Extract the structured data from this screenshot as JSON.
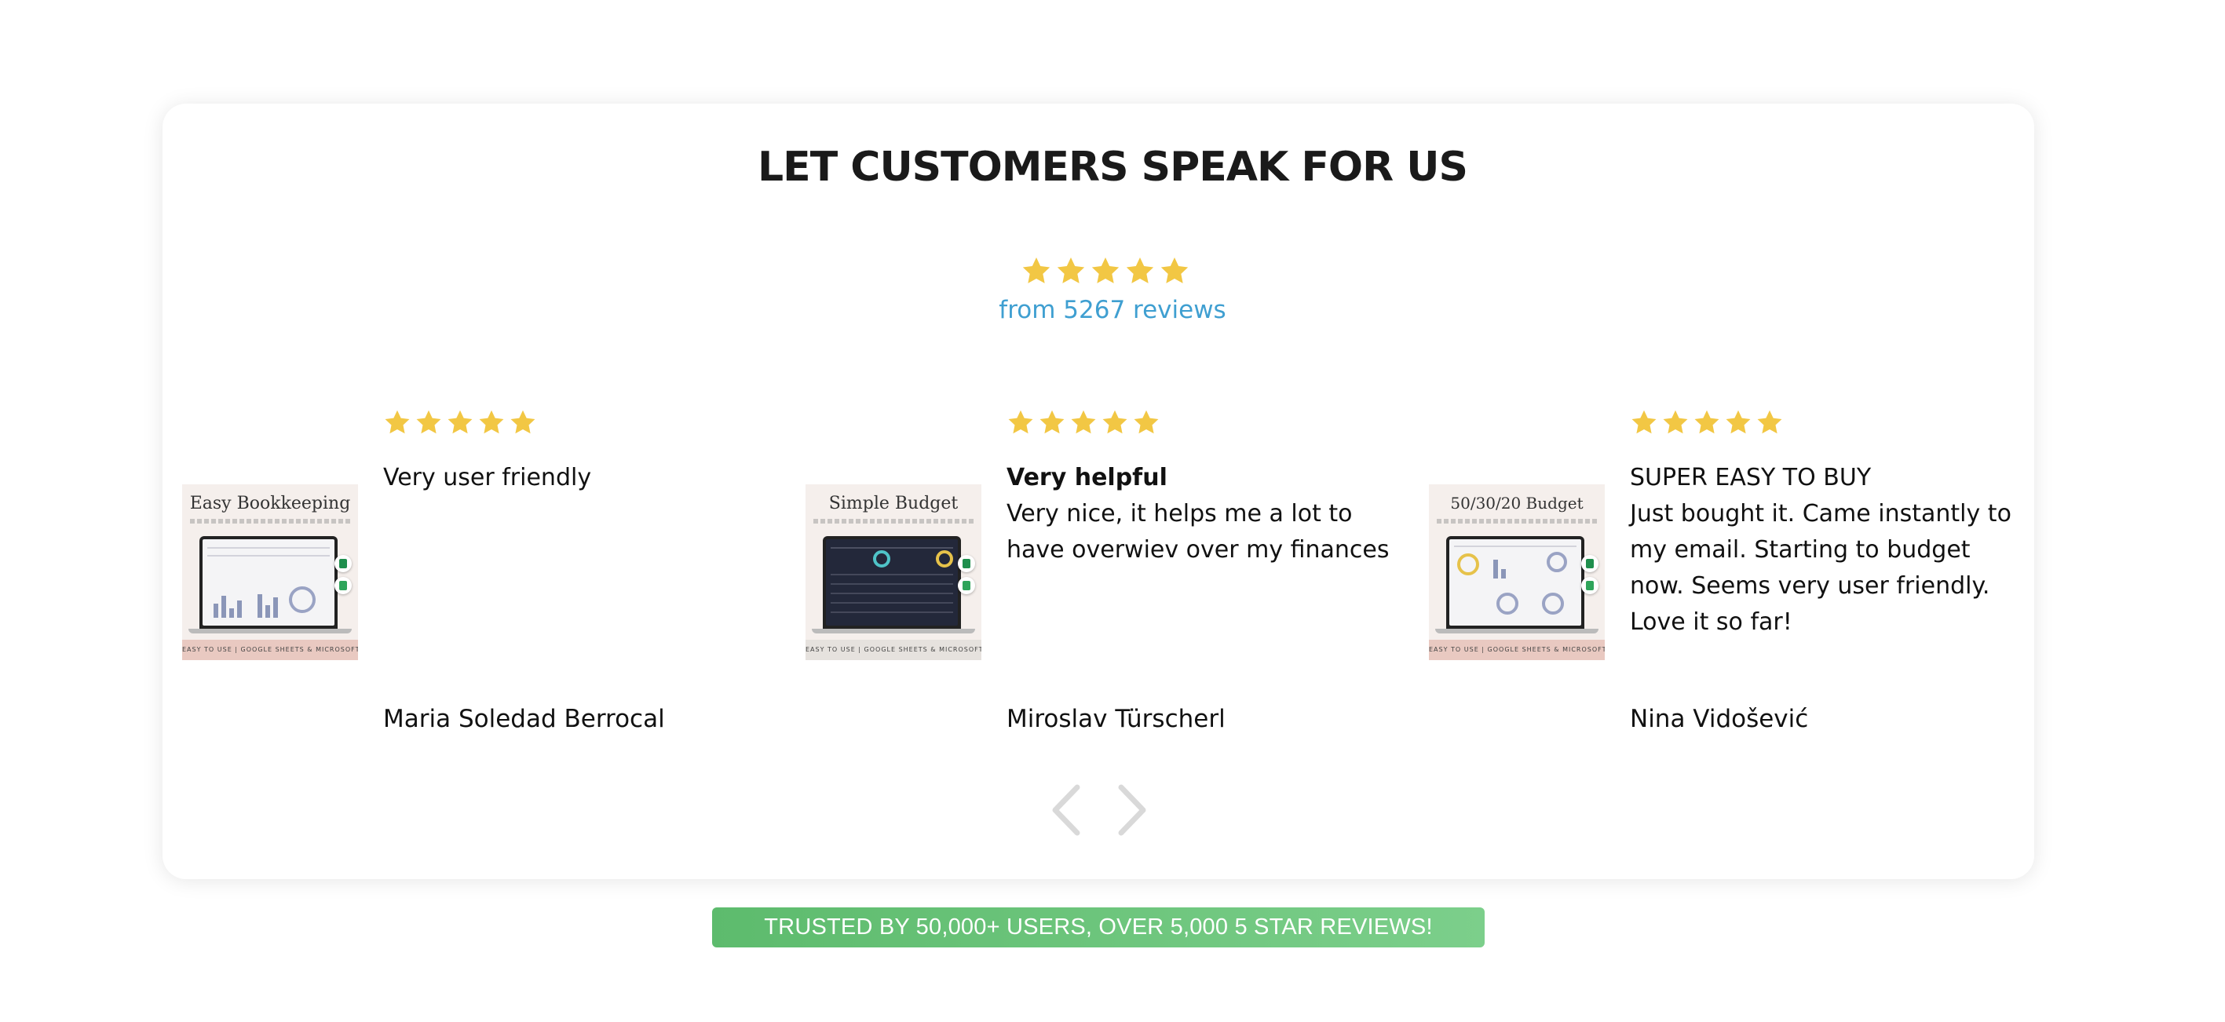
{
  "heading": "LET CUSTOMERS SPEAK FOR US",
  "summary": {
    "rating": 5,
    "text": "from 5267 reviews"
  },
  "reviews": [
    {
      "rating": 5,
      "title": "Very user friendly",
      "body": "",
      "author": "Maria Soledad Berrocal",
      "thumbnail": {
        "title": "Easy Bookkeeping",
        "footer": "EASY TO USE | GOOGLE SHEETS & MICROSOFT EXCEL"
      }
    },
    {
      "rating": 5,
      "title": "Very helpful",
      "body": "Very nice, it helps me a lot to have overwiev over my finances",
      "author": "Miroslav Türscherl",
      "thumbnail": {
        "title": "Simple Budget",
        "footer": "EASY TO USE | GOOGLE SHEETS & MICROSOFT EXCEL"
      }
    },
    {
      "rating": 5,
      "title": "SUPER EASY TO BUY",
      "body": "Just bought it. Came instantly to my email. Starting to budget now. Seems very user friendly. Love it so far!",
      "author": "Nina Vidošević",
      "thumbnail": {
        "title": "50/30/20 Budget",
        "footer": "EASY TO USE | GOOGLE SHEETS & MICROSOFT EXCEL"
      }
    }
  ],
  "nav": {
    "prev_icon": "chevron-left-icon",
    "next_icon": "chevron-right-icon"
  },
  "trust_banner": "TRUSTED BY 50,000+ USERS, OVER 5,000 5 STAR REVIEWS!",
  "colors": {
    "star": "#f2c744",
    "summary_link": "#3f9fd1",
    "banner": "#6cc47b",
    "arrow": "#d9d9d9"
  }
}
